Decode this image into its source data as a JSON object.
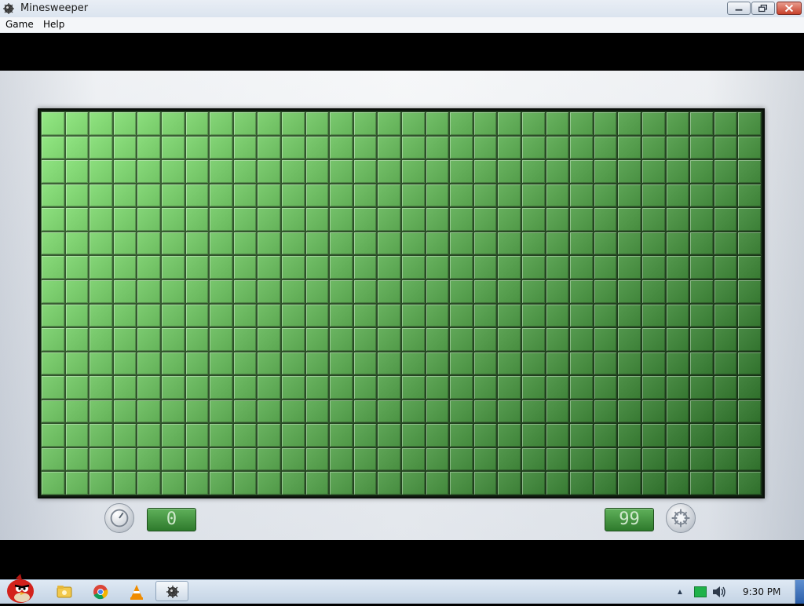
{
  "window": {
    "title": "Minesweeper",
    "icon": "mine-icon"
  },
  "menu": {
    "items": [
      {
        "label": "Game"
      },
      {
        "label": "Help"
      }
    ]
  },
  "game": {
    "board": {
      "columns": 30,
      "rows": 16,
      "state": "unrevealed",
      "cell_color": "#3c9a3a"
    },
    "timer": {
      "value": "0",
      "icon": "stopwatch-icon"
    },
    "mines_remaining": {
      "value": "99",
      "icon": "mine-icon"
    }
  },
  "taskbar": {
    "apps": [
      {
        "name": "angry-birds-icon"
      },
      {
        "name": "windows-explorer-icon"
      },
      {
        "name": "chrome-icon"
      },
      {
        "name": "vlc-icon"
      },
      {
        "name": "minesweeper-icon",
        "active": true
      }
    ],
    "tray": {
      "clock": "9:30 PM"
    }
  },
  "colors": {
    "board_green_light": "#7ed36f",
    "board_green_dark": "#2f6f2b",
    "counter_text": "#cfe9cc"
  }
}
